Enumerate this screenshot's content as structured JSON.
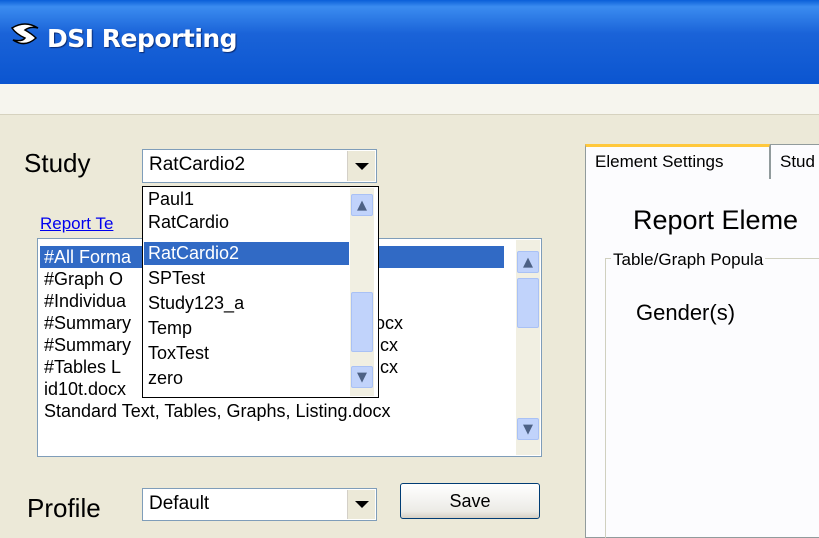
{
  "window": {
    "title": "DSI Reporting"
  },
  "study": {
    "label": "Study",
    "value": "RatCardio2"
  },
  "report_templates_link": "Report Te",
  "templates": {
    "items": [
      "#All Forma",
      "#Graph O",
      "#Individua",
      "#Summary",
      "#Summary",
      "#Tables L",
      "id10t.docx",
      "Standard Text, Tables, Graphs, Listing.docx"
    ],
    "selected_index": 0,
    "obscured_suffixes": [
      {
        "row": 3,
        "text": "ocx"
      },
      {
        "row": 4,
        "text": "cx"
      },
      {
        "row": 5,
        "text": "cx"
      }
    ]
  },
  "study_dropdown": {
    "options": [
      "Paul1",
      "RatCardio",
      "RatCardio2",
      "SPTest",
      "Study123_a",
      "Temp",
      "ToxTest",
      "zero"
    ],
    "selected_index": 2
  },
  "profile": {
    "label": "Profile",
    "value": "Default"
  },
  "save_button": "Save",
  "tabs": [
    {
      "label": "Element Settings",
      "active": true
    },
    {
      "label": "Stud",
      "active": false
    }
  ],
  "panel": {
    "title": "Report Eleme",
    "group_label": "Table/Graph Popula",
    "gender_label": "Gender(s)"
  },
  "colors": {
    "selection": "#316ac5",
    "titlebar": "#0b55d0",
    "link": "#0000ee"
  }
}
